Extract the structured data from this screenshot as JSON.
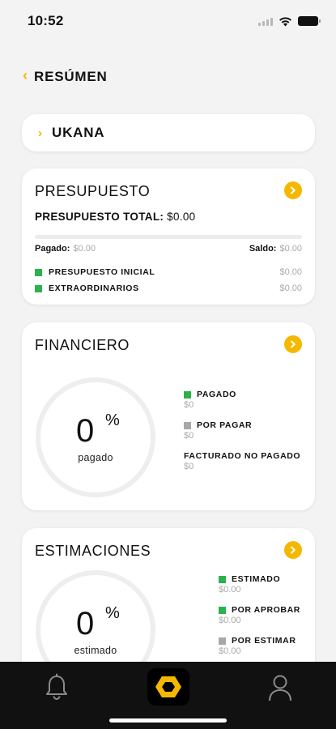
{
  "status": {
    "time": "10:52"
  },
  "nav": {
    "back_label": "RESÚMEN"
  },
  "project": {
    "name": "UKANA"
  },
  "presupuesto": {
    "title": "PRESUPUESTO",
    "total_label": "PRESUPUESTO TOTAL:",
    "total_value": "$0.00",
    "progress": 0,
    "pagado_label": "Pagado:",
    "pagado_value": "$0.00",
    "saldo_label": "Saldo:",
    "saldo_value": "$0.00",
    "items": [
      {
        "label": "PRESUPUESTO INICIAL",
        "value": "$0.00",
        "color": "#2bb24c"
      },
      {
        "label": "EXTRAORDINARIOS",
        "value": "$0.00",
        "color": "#2bb24c"
      }
    ]
  },
  "financiero": {
    "title": "FINANCIERO",
    "percent": "0",
    "percent_symbol": "%",
    "caption": "pagado",
    "legend": [
      {
        "label": "PAGADO",
        "value": "$0",
        "color": "#2bb24c"
      },
      {
        "label": "POR PAGAR",
        "value": "$0",
        "color": "#a8a8a8"
      },
      {
        "label": "FACTURADO NO PAGADO",
        "value": "$0"
      }
    ]
  },
  "estimaciones": {
    "title": "ESTIMACIONES",
    "percent": "0",
    "percent_symbol": "%",
    "caption": "estimado",
    "legend": [
      {
        "label": "ESTIMADO",
        "value": "$0.00",
        "color": "#2bb24c"
      },
      {
        "label": "POR APROBAR",
        "value": "$0.00",
        "color": "#2bb24c"
      },
      {
        "label": "POR ESTIMAR",
        "value": "$0.00",
        "color": "#a8a8a8"
      }
    ]
  },
  "tabbar": {
    "tabs": [
      "bell-icon",
      "home-logo-icon",
      "user-icon"
    ],
    "accent": "#f5b800"
  }
}
